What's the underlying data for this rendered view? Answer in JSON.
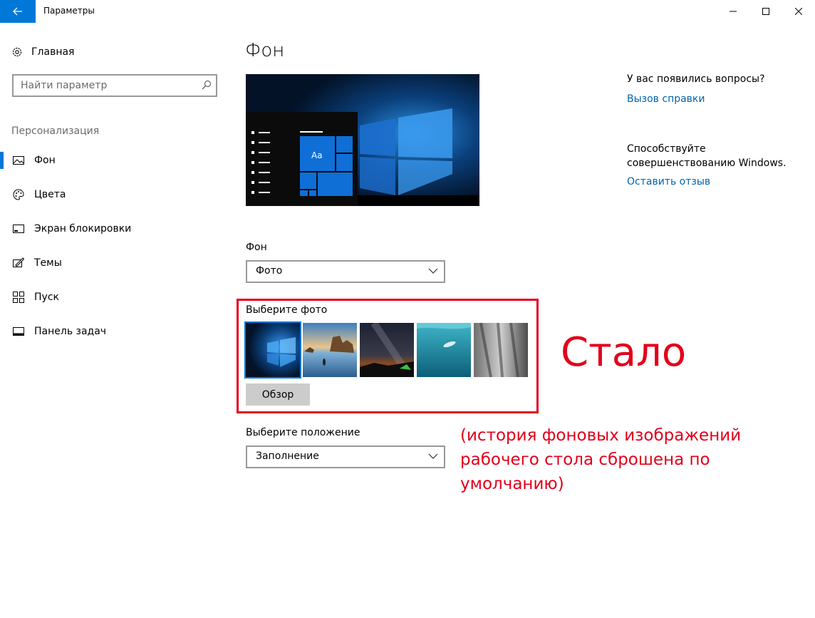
{
  "window": {
    "title": "Параметры",
    "accent_color": "#0078d7"
  },
  "sidebar": {
    "home_label": "Главная",
    "search_placeholder": "Найти параметр",
    "section_label": "Персонализация",
    "items": [
      {
        "label": "Фон",
        "icon": "picture-icon",
        "active": true
      },
      {
        "label": "Цвета",
        "icon": "palette-icon",
        "active": false
      },
      {
        "label": "Экран блокировки",
        "icon": "lock-screen-icon",
        "active": false
      },
      {
        "label": "Темы",
        "icon": "themes-icon",
        "active": false
      },
      {
        "label": "Пуск",
        "icon": "start-icon",
        "active": false
      },
      {
        "label": "Панель задач",
        "icon": "taskbar-icon",
        "active": false
      }
    ]
  },
  "main": {
    "title": "Фон",
    "background_label": "Фон",
    "background_value": "Фото",
    "choose_photo_label": "Выберите фото",
    "browse_label": "Обзор",
    "position_label": "Выберите положение",
    "position_value": "Заполнение",
    "preview_tile_text": "Aa"
  },
  "help": {
    "question": "У вас появились вопросы?",
    "get_help": "Вызов справки",
    "improve_text": "Способствуйте совершенствованию Windows.",
    "feedback": "Оставить отзыв"
  },
  "annotation": {
    "big": "Стало",
    "small": "(история фоновых изображений рабочего стола сброшена по умолчанию)",
    "color": "#e2001a"
  }
}
